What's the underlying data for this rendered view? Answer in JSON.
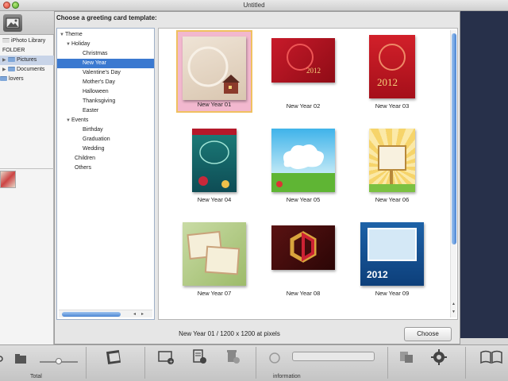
{
  "window": {
    "title": "Untitled"
  },
  "sidebar": {
    "items": [
      {
        "label": "iPhoto Library",
        "icon": "iphoto-icon"
      },
      {
        "label": "FOLDER",
        "icon": ""
      },
      {
        "label": "Pictures",
        "icon": "folder-icon",
        "selected": true
      },
      {
        "label": "Documents",
        "icon": "folder-icon"
      },
      {
        "label": "lovers",
        "icon": "folder-icon"
      }
    ]
  },
  "dialog": {
    "heading": "Choose a greeting card template:",
    "tree": [
      {
        "label": "Theme",
        "level": 0,
        "expanded": true
      },
      {
        "label": "Holiday",
        "level": 1,
        "expanded": true
      },
      {
        "label": "Christmas",
        "level": 2
      },
      {
        "label": "New Year",
        "level": 2,
        "selected": true
      },
      {
        "label": "Valentine's Day",
        "level": 2
      },
      {
        "label": "Mother's Day",
        "level": 2
      },
      {
        "label": "Halloween",
        "level": 2
      },
      {
        "label": "Thanksgiving",
        "level": 2
      },
      {
        "label": "Easter",
        "level": 2
      },
      {
        "label": "Events",
        "level": 1,
        "expanded": true
      },
      {
        "label": "Birthday",
        "level": 2
      },
      {
        "label": "Graduation",
        "level": 2
      },
      {
        "label": "Wedding",
        "level": 2
      },
      {
        "label": "Children",
        "level": 1
      },
      {
        "label": "Others",
        "level": 1
      }
    ],
    "templates": [
      {
        "label": "New Year 01",
        "selected": true
      },
      {
        "label": "New Year 02"
      },
      {
        "label": "New Year 03"
      },
      {
        "label": "New Year 04"
      },
      {
        "label": "New Year 05"
      },
      {
        "label": "New Year 06"
      },
      {
        "label": "New Year 07"
      },
      {
        "label": "New Year 08"
      },
      {
        "label": "New Year 09"
      }
    ],
    "status": "New Year 01 / 1200 x 1200 at pixels",
    "choose_label": "Choose"
  },
  "bottom": {
    "total_label": "Total",
    "information_label": "information"
  },
  "colors": {
    "selection_blue": "#3b79d0",
    "tile_selected": "#f2b8cf",
    "dark_pane": "#27304a"
  }
}
